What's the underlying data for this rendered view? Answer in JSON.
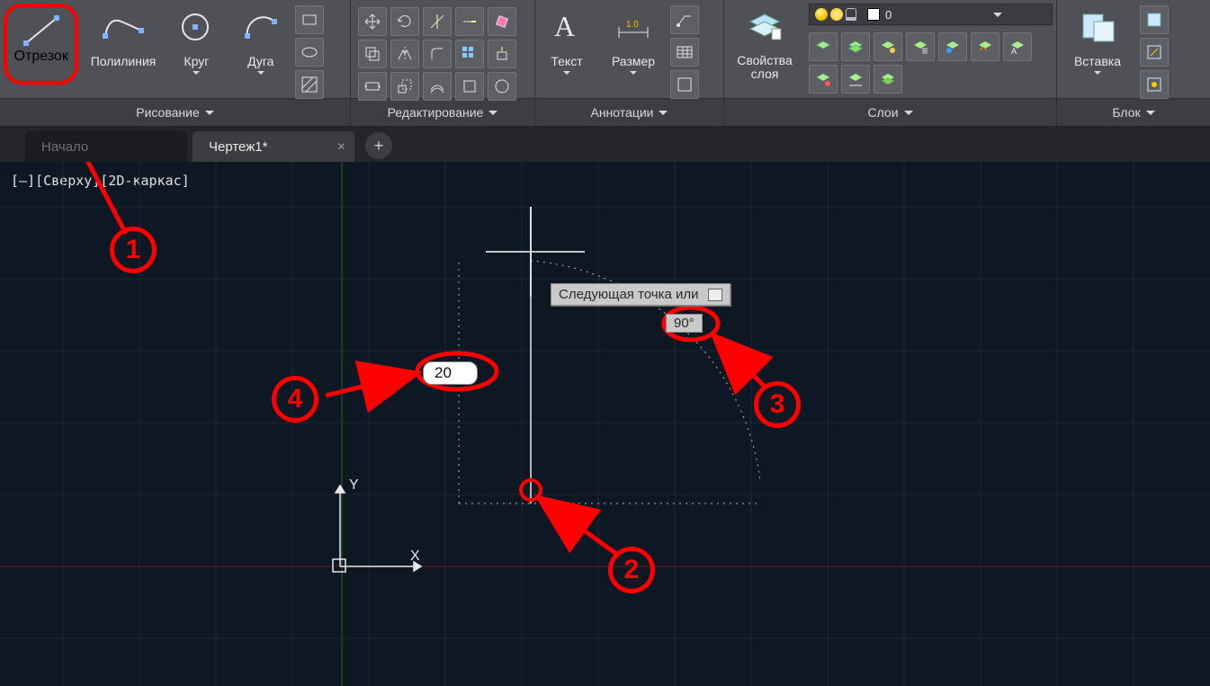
{
  "ribbon": {
    "draw": {
      "line": "Отрезок",
      "polyline": "Полилиния",
      "circle": "Круг",
      "arc": "Дуга",
      "title": "Рисование"
    },
    "modify": {
      "title": "Редактирование"
    },
    "annot": {
      "text": "Текст",
      "dim": "Размер",
      "title": "Аннотации"
    },
    "layers": {
      "big": "Свойства\nслоя",
      "big_l1": "Свойства",
      "big_l2": "слоя",
      "current": "0",
      "title": "Слои"
    },
    "block": {
      "insert": "Вставка",
      "title": "Блок"
    }
  },
  "tabs": {
    "home": "Начало",
    "active": "Чертеж1*"
  },
  "canvas": {
    "view_label": "[–][Сверху][2D-каркас]",
    "axis_x": "X",
    "axis_y": "Y",
    "tooltip": "Следующая точка или",
    "angle": "90°",
    "length": "20"
  },
  "callouts": {
    "c1": "1",
    "c2": "2",
    "c3": "3",
    "c4": "4"
  }
}
